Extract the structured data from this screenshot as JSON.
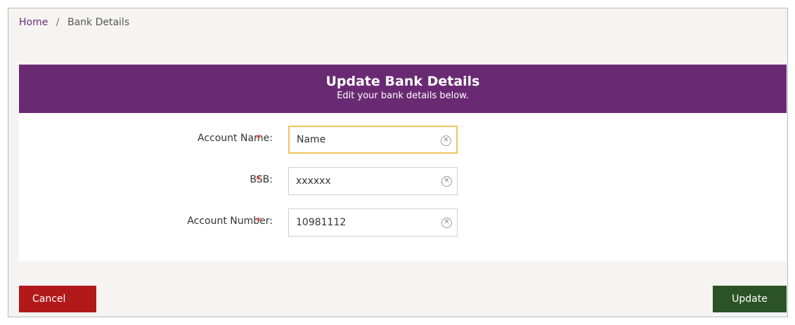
{
  "breadcrumb": {
    "home": "Home",
    "separator": "/",
    "current": "Bank Details"
  },
  "panel": {
    "title": "Update Bank Details",
    "subtitle": "Edit your bank details below."
  },
  "form": {
    "required_mark": "*",
    "fields": [
      {
        "label": "Account Name:",
        "value": "Name",
        "focused": true
      },
      {
        "label": "BSB:",
        "value": "xxxxxx"
      },
      {
        "label": "Account Number:",
        "value": "10981112"
      }
    ]
  },
  "buttons": {
    "cancel": "Cancel",
    "update": "Update"
  },
  "icons": {
    "clear": "clear-circle-x-icon"
  },
  "colors": {
    "header_bg": "#6a2a73",
    "cancel_bg": "#b21919",
    "update_bg": "#2c5327",
    "required": "#d9302a",
    "focus_border": "#f0c35c",
    "breadcrumb_link": "#6b2d7a"
  }
}
